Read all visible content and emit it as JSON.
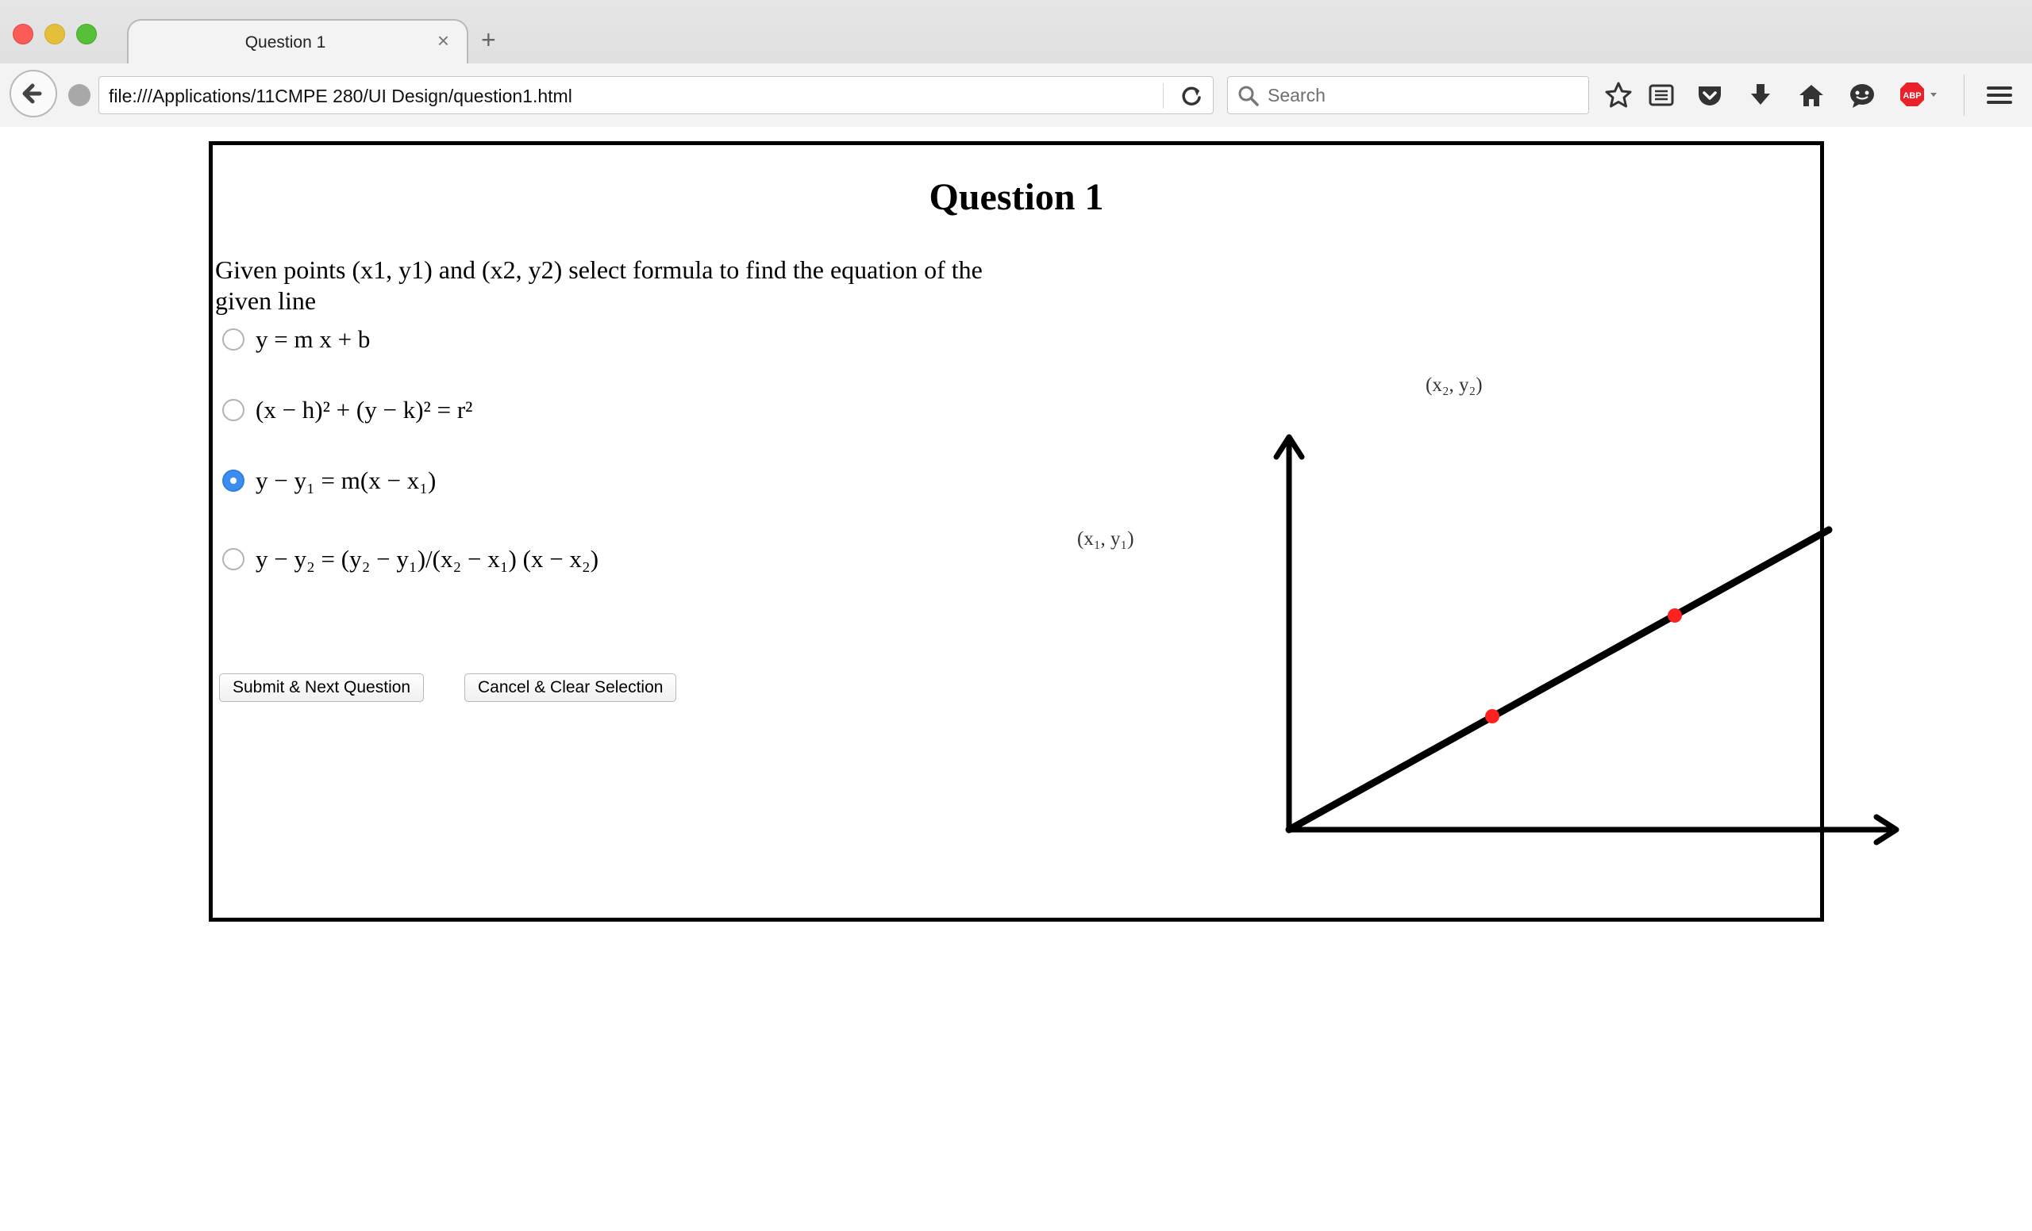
{
  "browser": {
    "tab_title": "Question 1",
    "tab_close_glyph": "×",
    "new_tab_glyph": "+",
    "url": "file:///Applications/11CMPE 280/UI Design/question1.html",
    "search_placeholder": "Search",
    "toolbar_icons": [
      "bookmark-star-icon",
      "reading-list-icon",
      "pocket-icon",
      "download-icon",
      "home-icon",
      "chat-icon",
      "adblock-plus-icon",
      "menu-icon"
    ]
  },
  "page": {
    "title": "Question 1",
    "prompt": "Given points (x1, y1) and (x2, y2) select formula to find the equation of the given line",
    "options": [
      {
        "id": "option-1",
        "formula": "y = m x + b",
        "selected": false
      },
      {
        "id": "option-2",
        "formula": "(x − h)² + (y − k)² = r²",
        "selected": false
      },
      {
        "id": "option-3",
        "formula": "y − y₁ = m(x − x₁)",
        "selected": true
      },
      {
        "id": "option-4",
        "formula": "y − y₂ = (y₂ − y₁)/(x₂ − x₁) (x − x₂)",
        "selected": false
      }
    ],
    "submit_label": "Submit & Next Question",
    "cancel_label": "Cancel & Clear Selection",
    "graph": {
      "point_1_label": "(x₁, y₁)",
      "point_2_label": "(x₂, y₂)",
      "point_color": "#ff2020",
      "line_color": "#000000"
    }
  },
  "colors": {
    "accent": "#3b8ef0",
    "close": "#fc5b57",
    "minimize": "#e5bf3c",
    "maximize": "#57c038",
    "adblock": "#e8212b"
  }
}
